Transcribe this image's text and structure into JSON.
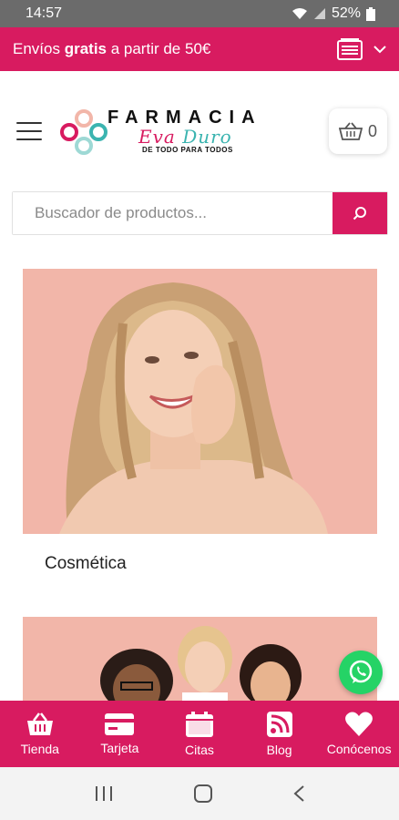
{
  "status_bar": {
    "time": "14:57",
    "battery": "52%"
  },
  "promo": {
    "prefix": "Envíos ",
    "bold": "gratis",
    "suffix": " a partir de 50€"
  },
  "header": {
    "logo": {
      "main": "FARMACIA",
      "script_a": "Eva ",
      "script_b": "Duro",
      "tagline": "DE TODO PARA TODOS"
    },
    "cart_count": "0"
  },
  "search": {
    "placeholder": "Buscador de productos..."
  },
  "categories": [
    {
      "title": "Cosmética"
    }
  ],
  "bottom_nav": {
    "items": [
      {
        "label": "Tienda",
        "icon": "basket-icon"
      },
      {
        "label": "Tarjeta",
        "icon": "card-icon"
      },
      {
        "label": "Citas",
        "icon": "calendar-icon"
      },
      {
        "label": "Blog",
        "icon": "rss-icon"
      },
      {
        "label": "Conócenos",
        "icon": "heart-icon"
      }
    ]
  },
  "colors": {
    "brand": "#d81b60",
    "teal": "#3bb4b0",
    "card_bg": "#f2b6a9",
    "whatsapp": "#25d366"
  }
}
